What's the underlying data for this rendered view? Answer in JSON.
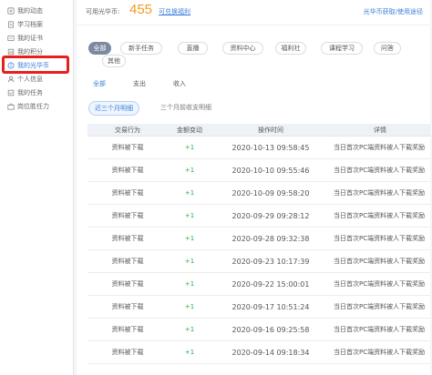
{
  "sidebar": {
    "items": [
      {
        "label": "我的动态",
        "icon": "activity-icon"
      },
      {
        "label": "学习档案",
        "icon": "document-icon"
      },
      {
        "label": "我的证书",
        "icon": "certificate-icon"
      },
      {
        "label": "我的积分",
        "icon": "points-icon"
      },
      {
        "label": "我的光华币",
        "icon": "coin-icon",
        "active": true
      },
      {
        "label": "个人信息",
        "icon": "user-icon"
      },
      {
        "label": "我的任务",
        "icon": "task-icon"
      },
      {
        "label": "岗位胜任力",
        "icon": "competency-icon"
      }
    ]
  },
  "header": {
    "coin_label": "可用光华币:",
    "coin_value": "455",
    "exchange_link": "可兑换福利",
    "howto_link": "光华币获取/使用途径"
  },
  "filters": [
    {
      "label": "全部",
      "active": true
    },
    {
      "label": "新手任务"
    },
    {
      "label": "直播"
    },
    {
      "label": "资料中心"
    },
    {
      "label": "福利社"
    },
    {
      "label": "课程学习"
    },
    {
      "label": "问答"
    },
    {
      "label": "其他"
    }
  ],
  "subtabs": [
    {
      "label": "全部",
      "active": true
    },
    {
      "label": "支出"
    },
    {
      "label": "收入"
    }
  ],
  "periods": [
    {
      "label": "近三个月明细",
      "active": true
    },
    {
      "label": "三个月前收支明细"
    }
  ],
  "table": {
    "headers": [
      "交易行为",
      "金额变动",
      "操作时间",
      "详情"
    ],
    "rows": [
      {
        "action": "资料被下载",
        "amount": "+1",
        "time": "2020-10-13 09:58:45",
        "detail": "当日首次PC端资料被人下载奖励"
      },
      {
        "action": "资料被下载",
        "amount": "+1",
        "time": "2020-10-10 09:55:46",
        "detail": "当日首次PC端资料被人下载奖励"
      },
      {
        "action": "资料被下载",
        "amount": "+1",
        "time": "2020-10-09 09:58:20",
        "detail": "当日首次PC端资料被人下载奖励"
      },
      {
        "action": "资料被下载",
        "amount": "+1",
        "time": "2020-09-29 09:28:12",
        "detail": "当日首次PC端资料被人下载奖励"
      },
      {
        "action": "资料被下载",
        "amount": "+1",
        "time": "2020-09-28 09:32:38",
        "detail": "当日首次PC端资料被人下载奖励"
      },
      {
        "action": "资料被下载",
        "amount": "+1",
        "time": "2020-09-23 10:17:39",
        "detail": "当日首次PC端资料被人下载奖励"
      },
      {
        "action": "资料被下载",
        "amount": "+1",
        "time": "2020-09-22 15:00:01",
        "detail": "当日首次PC端资料被人下载奖励"
      },
      {
        "action": "资料被下载",
        "amount": "+1",
        "time": "2020-09-17 10:51:24",
        "detail": "当日首次PC端资料被人下载奖励"
      },
      {
        "action": "资料被下载",
        "amount": "+1",
        "time": "2020-09-16 09:25:58",
        "detail": "当日首次PC端资料被人下载奖励"
      },
      {
        "action": "资料被下载",
        "amount": "+1",
        "time": "2020-09-14 09:18:34",
        "detail": "当日首次PC端资料被人下载奖励"
      }
    ]
  },
  "colors": {
    "accent": "#3b7ed9",
    "coin": "#f39a1d",
    "positive": "#2fae4f",
    "highlight": "#e8201c"
  }
}
